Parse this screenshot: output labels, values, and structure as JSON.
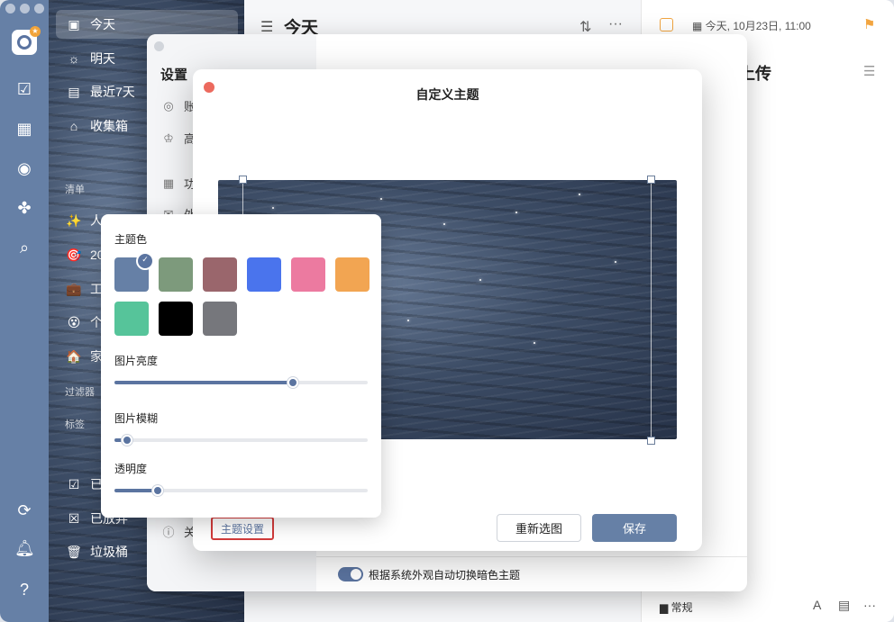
{
  "sidebar": {
    "items": [
      {
        "label": "今天",
        "icon": "calendar-today-icon"
      },
      {
        "label": "明天",
        "icon": "sunrise-icon"
      },
      {
        "label": "最近7天",
        "icon": "calendar-week-icon"
      },
      {
        "label": "收集箱",
        "icon": "inbox-icon"
      }
    ],
    "lists_header": "清单",
    "lists": [
      {
        "label": "人",
        "icon": "sparkle-icon"
      },
      {
        "label": "20",
        "icon": "target-icon"
      },
      {
        "label": "工",
        "icon": "briefcase-icon"
      },
      {
        "label": "个",
        "icon": "emoji-icon"
      },
      {
        "label": "家",
        "icon": "house-icon"
      }
    ],
    "filters_header": "过滤器",
    "tags_header": "标签",
    "completed_label": "已",
    "abandoned_label": "已放弃",
    "trash_label": "垃圾桶"
  },
  "main": {
    "title": "今天"
  },
  "detail": {
    "date": "今天, 10月23日, 11:00",
    "title_fragment": "容上传",
    "footer_list": "常规"
  },
  "settings": {
    "title": "设置",
    "rows": [
      {
        "label": "账",
        "icon": "user-icon"
      },
      {
        "label": "高",
        "icon": "crown-icon"
      },
      {
        "label": "功",
        "icon": "grid-icon"
      },
      {
        "label": "外",
        "icon": "shirt-icon"
      },
      {
        "label": "关",
        "icon": "info-icon"
      }
    ],
    "auto_dark_label": "根据系统外观自动切换暗色主题"
  },
  "custom_theme": {
    "title": "自定义主题",
    "reselect_label": "重新选图",
    "save_label": "保存",
    "theme_settings_label": "主题设置"
  },
  "theme_popup": {
    "color_label": "主题色",
    "colors": [
      "#6680a6",
      "#7d9a7c",
      "#9a666c",
      "#4a74ed",
      "#ec7aa0",
      "#f2a552",
      "#56c49a",
      "#000000",
      "#76777c"
    ],
    "selected_color": "#6680a6",
    "brightness_label": "图片亮度",
    "brightness": 0.705,
    "blur_label": "图片模糊",
    "blur": 0.05,
    "opacity_label": "透明度",
    "opacity": 0.17
  }
}
